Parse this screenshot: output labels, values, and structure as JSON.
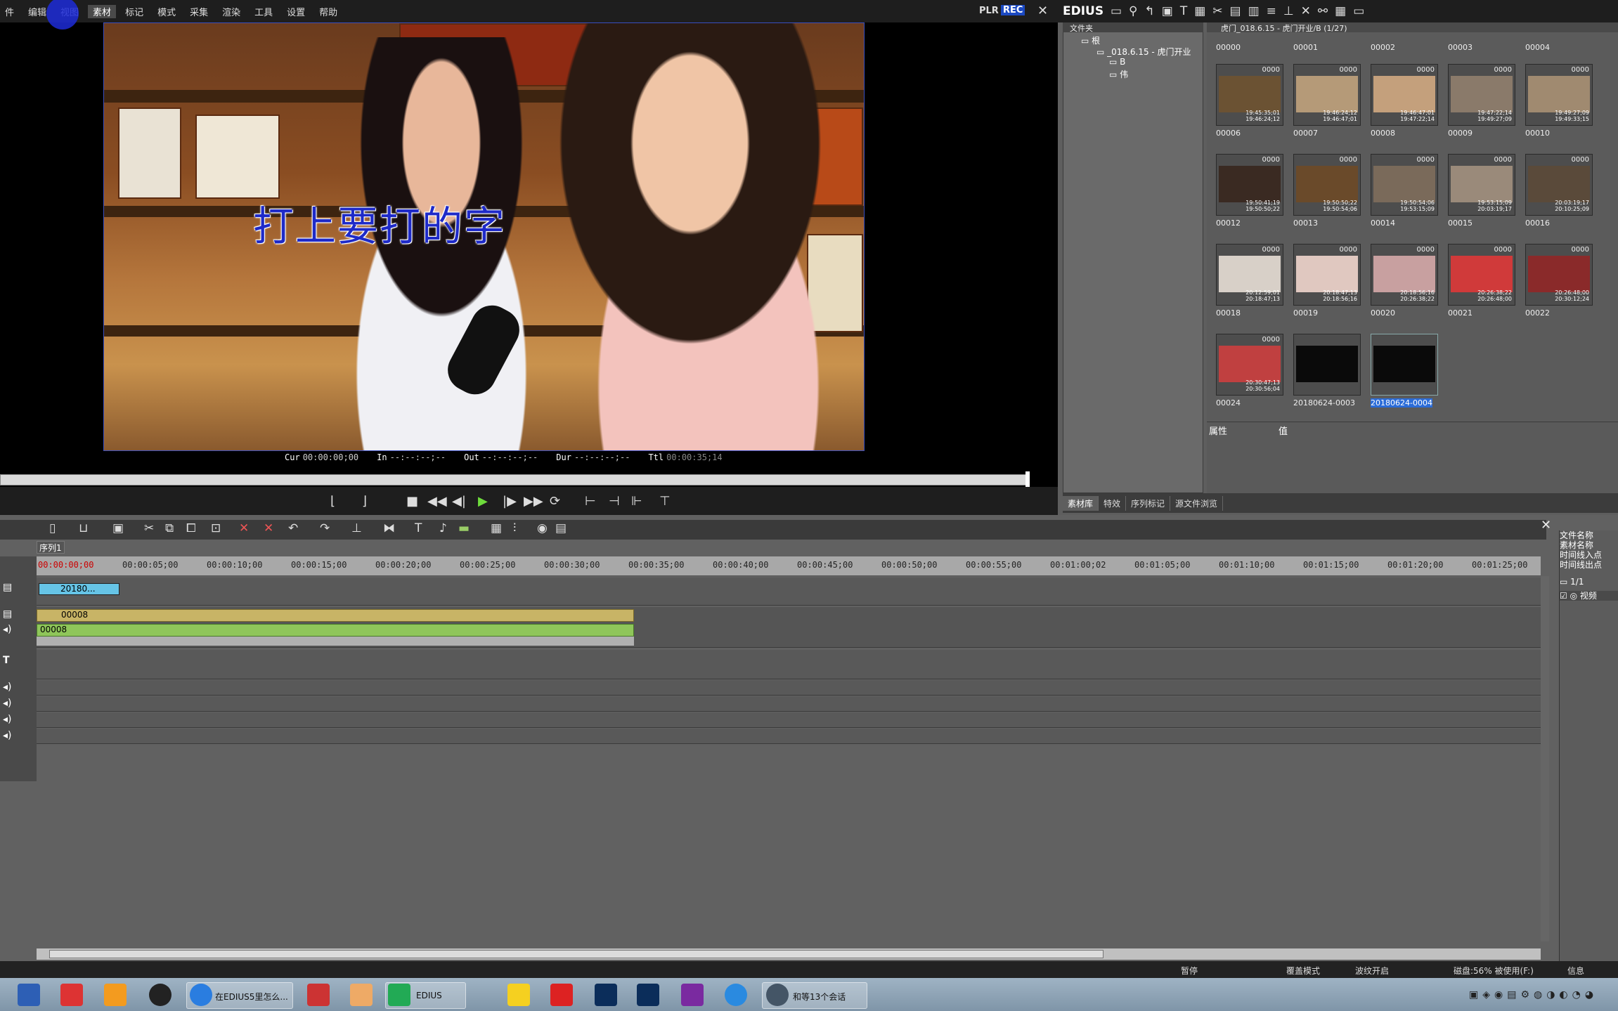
{
  "menu": [
    "件",
    "编辑",
    "视图",
    "素材",
    "标记",
    "模式",
    "采集",
    "渲染",
    "工具",
    "设置",
    "帮助"
  ],
  "menu_active": "素材",
  "player": {
    "plr": "PLR",
    "rec": "REC",
    "overlay_text": "打上要打的字",
    "cur_label": "Cur",
    "cur": "00:00:00;00",
    "in_label": "In",
    "in": "--:--:--;--",
    "out_label": "Out",
    "out": "--:--:--;--",
    "dur_label": "Dur",
    "dur": "--:--:--;--",
    "ttl_label": "Ttl",
    "ttl": "00:00:35;14"
  },
  "bin": {
    "app": "EDIUS",
    "folder_header": "文件夹",
    "path": "虎门_018.6.15 - 虎门开业/B (1/27)",
    "tree": [
      "根",
      "_018.6.15 - 虎门开业",
      "B",
      "伟"
    ],
    "top_row": [
      "00000",
      "00001",
      "00002",
      "00003",
      "00004"
    ],
    "clips": [
      {
        "name": "00006",
        "count": "0000",
        "tc1": "19:45:35;01",
        "tc2": "19:46:24;12"
      },
      {
        "name": "00007",
        "count": "0000",
        "tc1": "19:46:24;12",
        "tc2": "19:46:47;01"
      },
      {
        "name": "00008",
        "count": "0000",
        "tc1": "19:46:47;01",
        "tc2": "19:47:22;14"
      },
      {
        "name": "00009",
        "count": "0000",
        "tc1": "19:47:22;14",
        "tc2": "19:49:27;09"
      },
      {
        "name": "00010",
        "count": "0000",
        "tc1": "19:49:27;09",
        "tc2": "19:49:33;15"
      },
      {
        "name": "00012",
        "count": "0000",
        "tc1": "19:50:41;19",
        "tc2": "19:50:50;22"
      },
      {
        "name": "00013",
        "count": "0000",
        "tc1": "19:50:50;22",
        "tc2": "19:50:54;06"
      },
      {
        "name": "00014",
        "count": "0000",
        "tc1": "19:50:54;06",
        "tc2": "19:53:15;09"
      },
      {
        "name": "00015",
        "count": "0000",
        "tc1": "19:53:15;09",
        "tc2": "20:03:19;17"
      },
      {
        "name": "00016",
        "count": "0000",
        "tc1": "20:03:19;17",
        "tc2": "20:10:25;09"
      },
      {
        "name": "00018",
        "count": "0000",
        "tc1": "20:12:59;01",
        "tc2": "20:18:47;13"
      },
      {
        "name": "00019",
        "count": "0000",
        "tc1": "20:18:47;13",
        "tc2": "20:18:56;16"
      },
      {
        "name": "00020",
        "count": "0000",
        "tc1": "20:18:56;16",
        "tc2": "20:26:38;22"
      },
      {
        "name": "00021",
        "count": "0000",
        "tc1": "20:26:38;22",
        "tc2": "20:26:48;00"
      },
      {
        "name": "00022",
        "count": "0000",
        "tc1": "20:26:48;00",
        "tc2": "20:30:12;24"
      },
      {
        "name": "00024",
        "count": "0000",
        "tc1": "20:30:47;13",
        "tc2": "20:30:56;04"
      },
      {
        "name": "20180624-0003",
        "count": "",
        "tc1": "",
        "tc2": ""
      },
      {
        "name": "20180624-0004",
        "count": "",
        "tc1": "",
        "tc2": ""
      }
    ],
    "props_attr": "属性",
    "props_value": "值",
    "tabs": [
      "素材库",
      "特效",
      "序列标记",
      "源文件浏览"
    ]
  },
  "timeline": {
    "sequence": "序列1",
    "ruler": [
      "00:00:00;00",
      "00:00:05;00",
      "00:00:10;00",
      "00:00:15;00",
      "00:00:20;00",
      "00:00:25;00",
      "00:00:30;00",
      "00:00:35;00",
      "00:00:40;00",
      "00:00:45;00",
      "00:00:50;00",
      "00:00:55;00",
      "00:01:00;02",
      "00:01:05;00",
      "00:01:10;00",
      "00:01:15;00",
      "00:01:20;00",
      "00:01:25;00"
    ],
    "title_clip": "20180...",
    "video_clip": "00008",
    "audio_clip": "00008"
  },
  "right_panel": {
    "lines": [
      "文件名称",
      "素材名称",
      "时间线入点",
      "时间线出点"
    ],
    "page": "1/1",
    "item": "视频"
  },
  "status": {
    "pause": "暂停",
    "mode": "覆盖模式",
    "ripple": "波纹开启",
    "disk": "磁盘:56% 被使用(F:)",
    "info": "信息"
  },
  "taskbar": {
    "item1": "在EDIUS5里怎么...",
    "item2": "EDIUS",
    "item3": "和等13个会话"
  }
}
